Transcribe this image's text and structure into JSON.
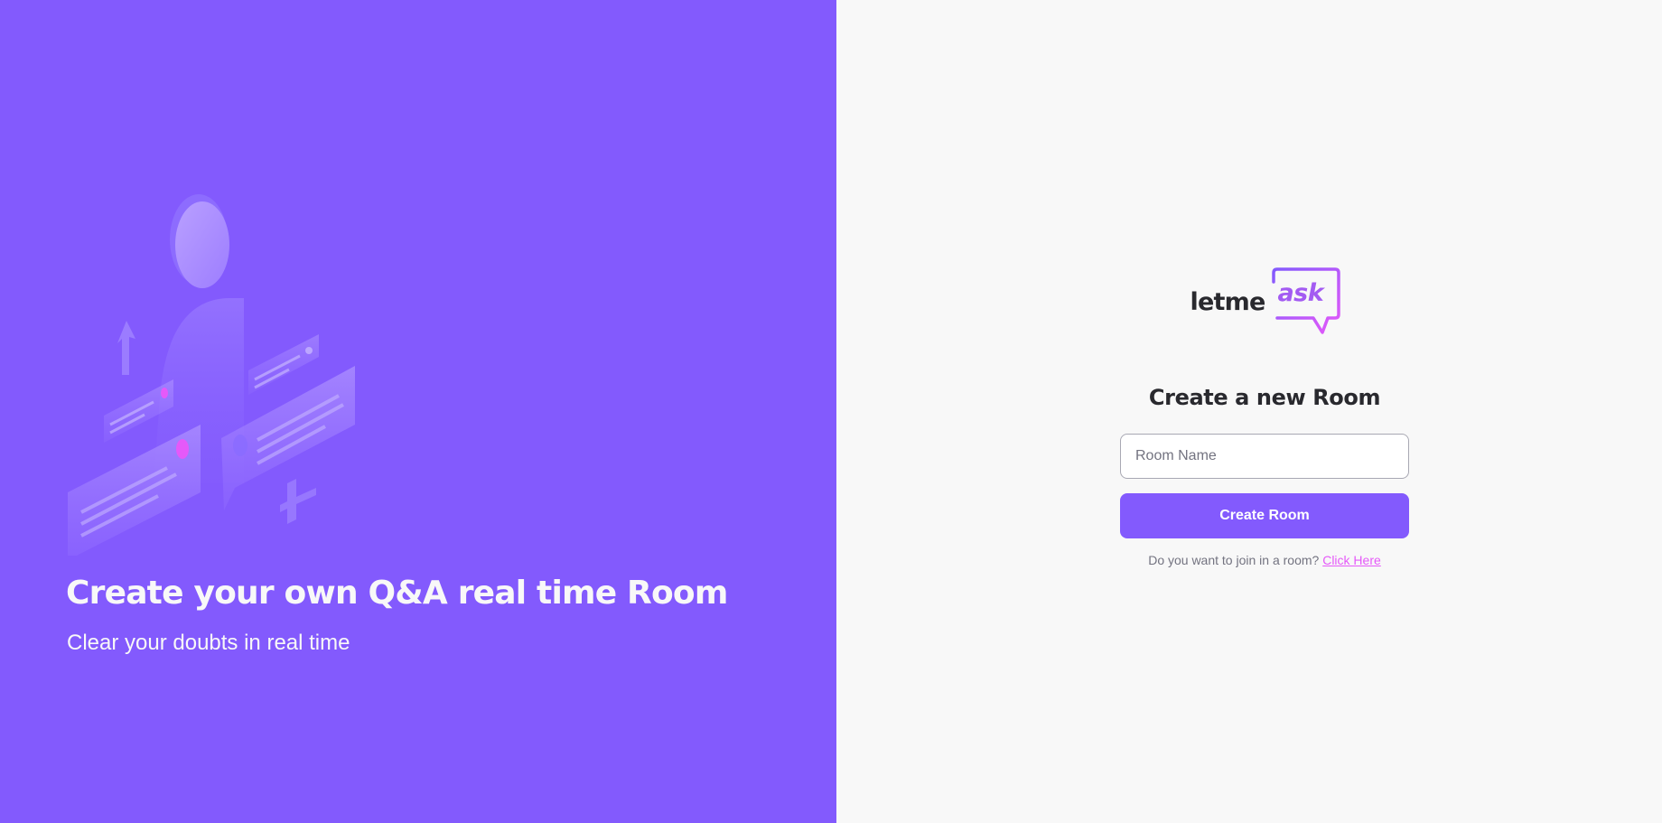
{
  "aside": {
    "title": "Create your own Q&A real time Room",
    "subtitle": "Clear your doubts in real time",
    "illustration": "qa-illustration"
  },
  "logo": {
    "part1": "letme",
    "part2": "ask"
  },
  "main": {
    "title": "Create a new Room",
    "input_placeholder": "Room Name",
    "input_value": "",
    "button_label": "Create Room",
    "join_text": "Do you want to join in a room?",
    "join_link": "Click Here"
  },
  "colors": {
    "brand_purple": "#835afd",
    "brand_pink": "#e559f9",
    "background": "#f8f8f8",
    "text_dark": "#29292e",
    "text_muted": "#737380"
  }
}
